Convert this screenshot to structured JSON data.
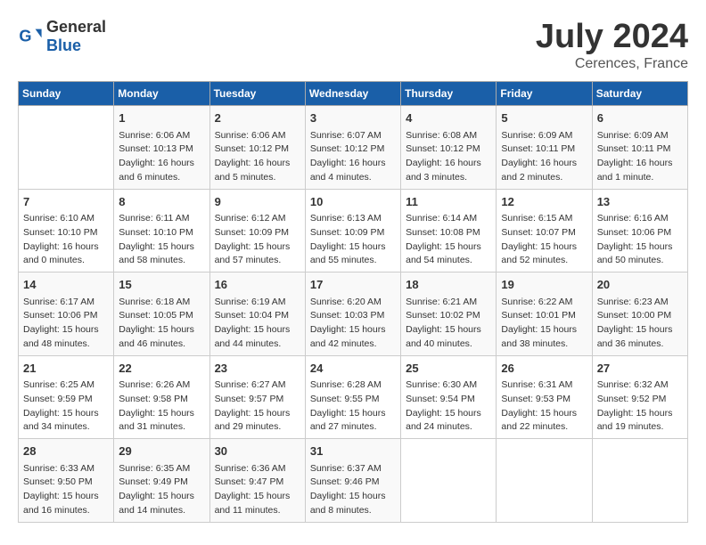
{
  "header": {
    "logo_general": "General",
    "logo_blue": "Blue",
    "title": "July 2024",
    "location": "Cerences, France"
  },
  "weekdays": [
    "Sunday",
    "Monday",
    "Tuesday",
    "Wednesday",
    "Thursday",
    "Friday",
    "Saturday"
  ],
  "weeks": [
    [
      {
        "day": "",
        "info": ""
      },
      {
        "day": "1",
        "info": "Sunrise: 6:06 AM\nSunset: 10:13 PM\nDaylight: 16 hours\nand 6 minutes."
      },
      {
        "day": "2",
        "info": "Sunrise: 6:06 AM\nSunset: 10:12 PM\nDaylight: 16 hours\nand 5 minutes."
      },
      {
        "day": "3",
        "info": "Sunrise: 6:07 AM\nSunset: 10:12 PM\nDaylight: 16 hours\nand 4 minutes."
      },
      {
        "day": "4",
        "info": "Sunrise: 6:08 AM\nSunset: 10:12 PM\nDaylight: 16 hours\nand 3 minutes."
      },
      {
        "day": "5",
        "info": "Sunrise: 6:09 AM\nSunset: 10:11 PM\nDaylight: 16 hours\nand 2 minutes."
      },
      {
        "day": "6",
        "info": "Sunrise: 6:09 AM\nSunset: 10:11 PM\nDaylight: 16 hours\nand 1 minute."
      }
    ],
    [
      {
        "day": "7",
        "info": "Sunrise: 6:10 AM\nSunset: 10:10 PM\nDaylight: 16 hours\nand 0 minutes."
      },
      {
        "day": "8",
        "info": "Sunrise: 6:11 AM\nSunset: 10:10 PM\nDaylight: 15 hours\nand 58 minutes."
      },
      {
        "day": "9",
        "info": "Sunrise: 6:12 AM\nSunset: 10:09 PM\nDaylight: 15 hours\nand 57 minutes."
      },
      {
        "day": "10",
        "info": "Sunrise: 6:13 AM\nSunset: 10:09 PM\nDaylight: 15 hours\nand 55 minutes."
      },
      {
        "day": "11",
        "info": "Sunrise: 6:14 AM\nSunset: 10:08 PM\nDaylight: 15 hours\nand 54 minutes."
      },
      {
        "day": "12",
        "info": "Sunrise: 6:15 AM\nSunset: 10:07 PM\nDaylight: 15 hours\nand 52 minutes."
      },
      {
        "day": "13",
        "info": "Sunrise: 6:16 AM\nSunset: 10:06 PM\nDaylight: 15 hours\nand 50 minutes."
      }
    ],
    [
      {
        "day": "14",
        "info": "Sunrise: 6:17 AM\nSunset: 10:06 PM\nDaylight: 15 hours\nand 48 minutes."
      },
      {
        "day": "15",
        "info": "Sunrise: 6:18 AM\nSunset: 10:05 PM\nDaylight: 15 hours\nand 46 minutes."
      },
      {
        "day": "16",
        "info": "Sunrise: 6:19 AM\nSunset: 10:04 PM\nDaylight: 15 hours\nand 44 minutes."
      },
      {
        "day": "17",
        "info": "Sunrise: 6:20 AM\nSunset: 10:03 PM\nDaylight: 15 hours\nand 42 minutes."
      },
      {
        "day": "18",
        "info": "Sunrise: 6:21 AM\nSunset: 10:02 PM\nDaylight: 15 hours\nand 40 minutes."
      },
      {
        "day": "19",
        "info": "Sunrise: 6:22 AM\nSunset: 10:01 PM\nDaylight: 15 hours\nand 38 minutes."
      },
      {
        "day": "20",
        "info": "Sunrise: 6:23 AM\nSunset: 10:00 PM\nDaylight: 15 hours\nand 36 minutes."
      }
    ],
    [
      {
        "day": "21",
        "info": "Sunrise: 6:25 AM\nSunset: 9:59 PM\nDaylight: 15 hours\nand 34 minutes."
      },
      {
        "day": "22",
        "info": "Sunrise: 6:26 AM\nSunset: 9:58 PM\nDaylight: 15 hours\nand 31 minutes."
      },
      {
        "day": "23",
        "info": "Sunrise: 6:27 AM\nSunset: 9:57 PM\nDaylight: 15 hours\nand 29 minutes."
      },
      {
        "day": "24",
        "info": "Sunrise: 6:28 AM\nSunset: 9:55 PM\nDaylight: 15 hours\nand 27 minutes."
      },
      {
        "day": "25",
        "info": "Sunrise: 6:30 AM\nSunset: 9:54 PM\nDaylight: 15 hours\nand 24 minutes."
      },
      {
        "day": "26",
        "info": "Sunrise: 6:31 AM\nSunset: 9:53 PM\nDaylight: 15 hours\nand 22 minutes."
      },
      {
        "day": "27",
        "info": "Sunrise: 6:32 AM\nSunset: 9:52 PM\nDaylight: 15 hours\nand 19 minutes."
      }
    ],
    [
      {
        "day": "28",
        "info": "Sunrise: 6:33 AM\nSunset: 9:50 PM\nDaylight: 15 hours\nand 16 minutes."
      },
      {
        "day": "29",
        "info": "Sunrise: 6:35 AM\nSunset: 9:49 PM\nDaylight: 15 hours\nand 14 minutes."
      },
      {
        "day": "30",
        "info": "Sunrise: 6:36 AM\nSunset: 9:47 PM\nDaylight: 15 hours\nand 11 minutes."
      },
      {
        "day": "31",
        "info": "Sunrise: 6:37 AM\nSunset: 9:46 PM\nDaylight: 15 hours\nand 8 minutes."
      },
      {
        "day": "",
        "info": ""
      },
      {
        "day": "",
        "info": ""
      },
      {
        "day": "",
        "info": ""
      }
    ]
  ]
}
